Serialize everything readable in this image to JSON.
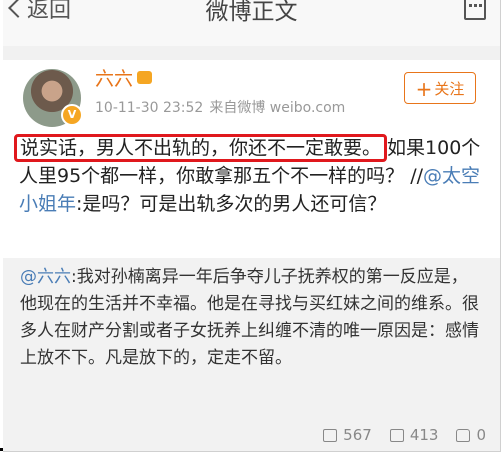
{
  "nav": {
    "back_label": "返回",
    "title": "微博正文"
  },
  "post": {
    "author": "六六",
    "time": "10-11-30 23:52",
    "source": "来自微博 weibo.com",
    "follow_label": "关注",
    "follow_plus": "+",
    "highlighted_text": "说实话，男人不出轨的，你还不一定敢要。",
    "text_rest_1": "如果100个人里95个都一样，你敢拿那五个不一样的吗？ //",
    "mention": "@太空小姐年",
    "text_rest_2": ":是吗？可是出轨多次的男人还可信？"
  },
  "repost": {
    "mention": "@六六",
    "text": ":我对孙楠离异一年后争夺儿子抚养权的第一反应是，他现在的生活并不幸福。他是在寻找与买红妹之间的维系。很多人在财产分割或者子女抚养上纠缠不清的唯一原因是：感情上放不下。凡是放下的，定走不留。",
    "reposts": "567",
    "comments": "413",
    "likes": "0"
  }
}
